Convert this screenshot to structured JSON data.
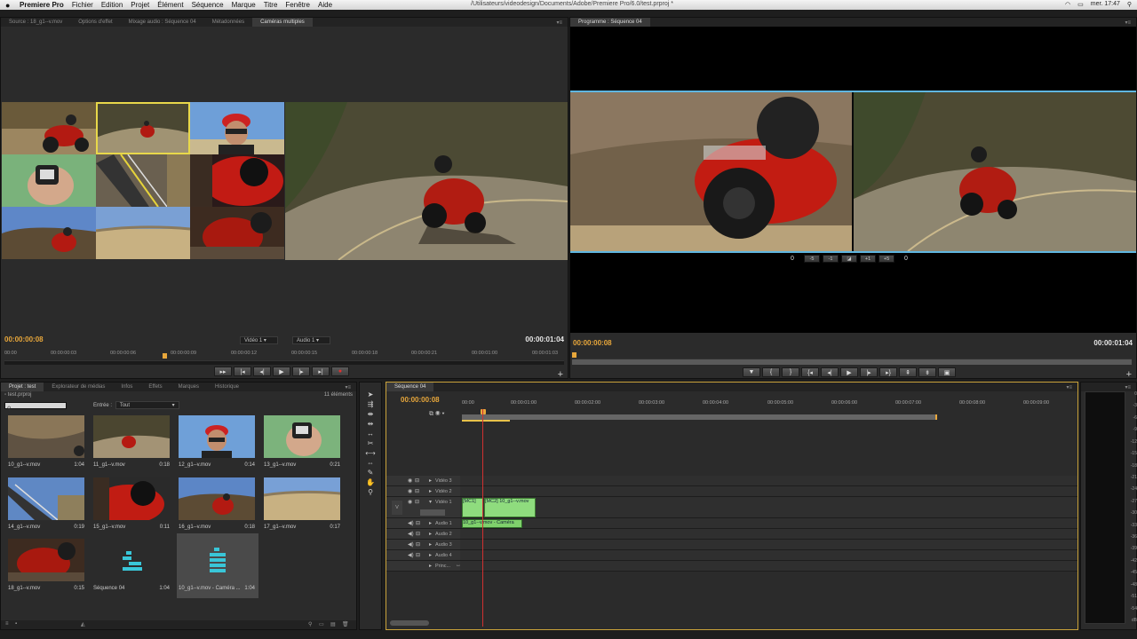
{
  "menubar": {
    "app_name": "Premiere Pro",
    "items": [
      "Fichier",
      "Edition",
      "Projet",
      "Élément",
      "Séquence",
      "Marque",
      "Titre",
      "Fenêtre",
      "Aide"
    ],
    "path": "/Utilisateurs/videodesign/Documents/Adobe/Premiere Pro/6.0/test.prproj *",
    "clock": "mer. 17:47"
  },
  "source_panel": {
    "tabs": [
      "Source : 18_g1--v.mov",
      "Options d'effet",
      "Mixage audio : Séquence 04",
      "Métadonnées",
      "Caméras multiples"
    ],
    "active_tab": 4,
    "timecode_left": "00:00:00:08",
    "timecode_right": "00:00:01:04",
    "video_dropdown": "Vidéo 1",
    "audio_dropdown": "Audio 1",
    "ruler": [
      "00:00",
      "00:00:00:03",
      "00:00:00:06",
      "00:00:00:09",
      "00:00:00:12",
      "00:00:00:15",
      "00:00:00:18",
      "00:00:00:21",
      "00:00:01:00",
      "00:00:01:03"
    ]
  },
  "program_panel": {
    "tabs": [
      "Programme : Séquence 04"
    ],
    "timecode_left": "00:00:00:08",
    "timecode_right": "00:00:01:04",
    "trim_left_value": "0",
    "trim_right_value": "0",
    "trim_buttons": [
      "-5",
      "-1",
      "◪",
      "+1",
      "+5"
    ]
  },
  "project_panel": {
    "tabs": [
      "Projet : test",
      "Explorateur de médias",
      "Infos",
      "Effets",
      "Marques",
      "Historique"
    ],
    "active_tab": 0,
    "project_file": "test.prproj",
    "item_count": "11 éléments",
    "entry_label": "Entrée :",
    "entry_value": "Tout",
    "clips": [
      {
        "name": "10_g1--v.mov",
        "dur": "1:04",
        "thumb": "road"
      },
      {
        "name": "11_g1--v.mov",
        "dur": "0:18",
        "thumb": "bike_far"
      },
      {
        "name": "12_g1--v.mov",
        "dur": "0:14",
        "thumb": "rider"
      },
      {
        "name": "13_g1--v.mov",
        "dur": "0:21",
        "thumb": "watch"
      },
      {
        "name": "14_g1--v.mov",
        "dur": "0:19",
        "thumb": "blur"
      },
      {
        "name": "15_g1--v.mov",
        "dur": "0:11",
        "thumb": "helmet"
      },
      {
        "name": "16_g1--v.mov",
        "dur": "0:18",
        "thumb": "bike_side"
      },
      {
        "name": "17_g1--v.mov",
        "dur": "0:17",
        "thumb": "landscape"
      },
      {
        "name": "18_g1--v.mov",
        "dur": "0:15",
        "thumb": "closeup"
      },
      {
        "name": "Séquence 04",
        "dur": "1:04",
        "thumb": "seq"
      },
      {
        "name": "10_g1--v.mov - Caméra ...",
        "dur": "1:04",
        "thumb": "seq2"
      }
    ]
  },
  "timeline": {
    "tab": "Séquence 04",
    "timecode": "00:00:00:08",
    "ruler": [
      "00:00",
      "00:00:01:00",
      "00:00:02:00",
      "00:00:03:00",
      "00:00:04:00",
      "00:00:05:00",
      "00:00:06:00",
      "00:00:07:00",
      "00:00:08:00",
      "00:00:09:00"
    ],
    "tracks": [
      "Vidéo 3",
      "Vidéo 2",
      "Vidéo 1",
      "Audio 1",
      "Audio 2",
      "Audio 3",
      "Audio 4",
      "Princ..."
    ],
    "video_clip_1": "[MC1]",
    "video_clip_2": "[MC2] 10_g1--v.mov",
    "audio_clip": "10_g1--v.mov - Caméra",
    "v_label": "V"
  },
  "meters": {
    "scale": [
      "0",
      "-3",
      "-6",
      "-9",
      "-12",
      "-15",
      "-18",
      "-21",
      "-24",
      "-27",
      "-30",
      "-33",
      "-36",
      "-39",
      "-42",
      "-45",
      "-48",
      "-51",
      "-54",
      "dB"
    ]
  }
}
